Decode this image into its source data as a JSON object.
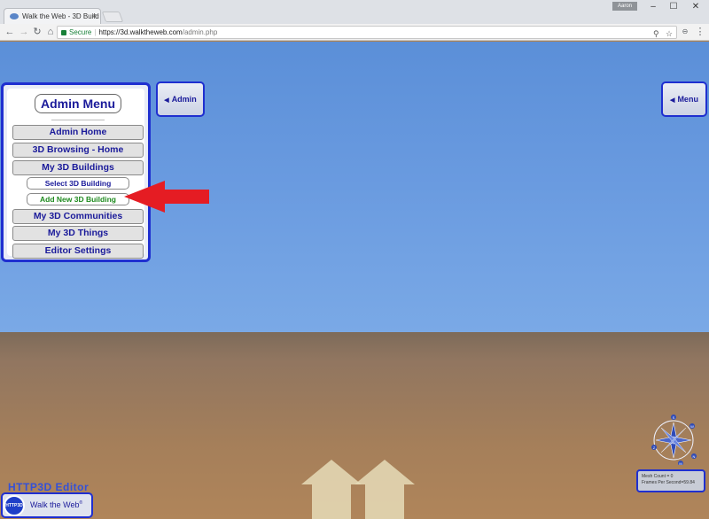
{
  "browser": {
    "tab_title": "Walk the Web - 3D Build",
    "tab_close": "×",
    "profile": "Aaron",
    "win_minimize": "–",
    "win_maximize": "☐",
    "win_close": "✕",
    "secure_label": "Secure",
    "url_host": "https://3d.walktheweb.com",
    "url_path": "/admin.php"
  },
  "admin_menu": {
    "title": "Admin Menu",
    "items": [
      {
        "label": "Admin Home"
      },
      {
        "label": "3D Browsing - Home"
      },
      {
        "label": "My 3D Buildings"
      },
      {
        "label": "Select 3D Building"
      },
      {
        "label": "Add New 3D Building"
      },
      {
        "label": "My 3D Communities"
      },
      {
        "label": "My 3D Things"
      },
      {
        "label": "Editor Settings"
      }
    ]
  },
  "side_buttons": {
    "admin": "Admin",
    "menu": "Menu"
  },
  "compass": {
    "letters": [
      "S",
      "W",
      "Z",
      "M",
      "N"
    ]
  },
  "stats": {
    "mesh_count": "Mesh Count = 0",
    "fps": "Frames Per Second=59.84"
  },
  "footer": {
    "editor_label": "HTTP3D Editor",
    "brand": "Walk the Web",
    "logo_text": "HTTP3D",
    "reg": "®"
  },
  "colors": {
    "panel_border": "#1f2fd0",
    "arrow": "#e51c23",
    "sky": "#6a9be0",
    "ground": "#a57f5a"
  }
}
